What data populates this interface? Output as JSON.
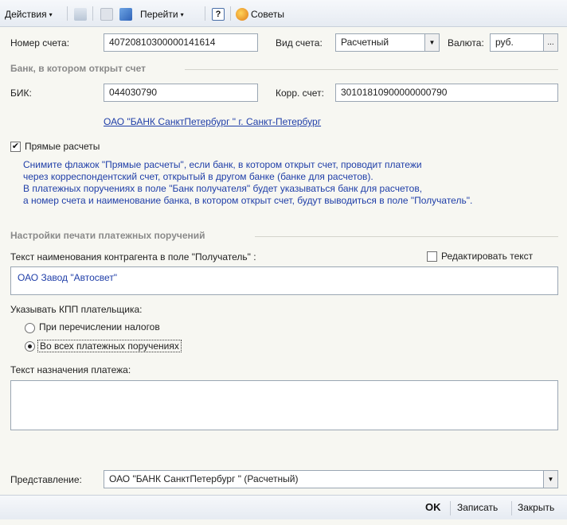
{
  "toolbar": {
    "actions_label": "Действия",
    "goto_label": "Перейти",
    "help_label": "?",
    "tips_label": "Советы"
  },
  "account": {
    "number_label": "Номер счета:",
    "number_value": "40720810300000141614",
    "type_label": "Вид счета:",
    "type_value": "Расчетный",
    "currency_label": "Валюта:",
    "currency_value": "руб.",
    "currency_btn": "..."
  },
  "bank_section": {
    "title": "Банк, в котором открыт счет",
    "bik_label": "БИК:",
    "bik_value": "044030790",
    "corr_label": "Корр. счет:",
    "corr_value": "30101810900000000790",
    "bank_link": "ОАО \"БАНК СанктПетербург \" г. Санкт-Петербург"
  },
  "direct": {
    "label": "Прямые расчеты",
    "checked": true,
    "hint_lines": [
      "Снимите флажок \"Прямые расчеты\", если банк, в котором открыт счет, проводит платежи",
      "через корреспондентский счет, открытый в другом банке (банке для расчетов).",
      "В платежных поручениях в поле \"Банк получателя\" будет указываться банк для расчетов,",
      "а номер счета и наименование банка, в котором открыт счет, будут выводиться в поле \"Получатель\"."
    ]
  },
  "print_section": {
    "title": "Настройки печати платежных поручений",
    "recipient_label": "Текст наименования контрагента в поле \"Получатель\" :",
    "edit_text_label": "Редактировать текст",
    "recipient_text": "ОАО Завод \"Автосвет\"",
    "kpp_label": "Указывать КПП плательщика:",
    "radio_taxes": "При перечислении налогов",
    "radio_all": "Во всех платежных поручениях",
    "purpose_label": "Текст назначения платежа:",
    "purpose_text": ""
  },
  "representation": {
    "label": "Представление:",
    "value": "ОАО \"БАНК СанктПетербург \" (Расчетный)"
  },
  "buttons": {
    "ok": "OK",
    "save": "Записать",
    "close": "Закрыть"
  },
  "colors": {
    "link": "#1f3ea8",
    "section": "#8a8a8a",
    "background": "#f7f7f2"
  }
}
